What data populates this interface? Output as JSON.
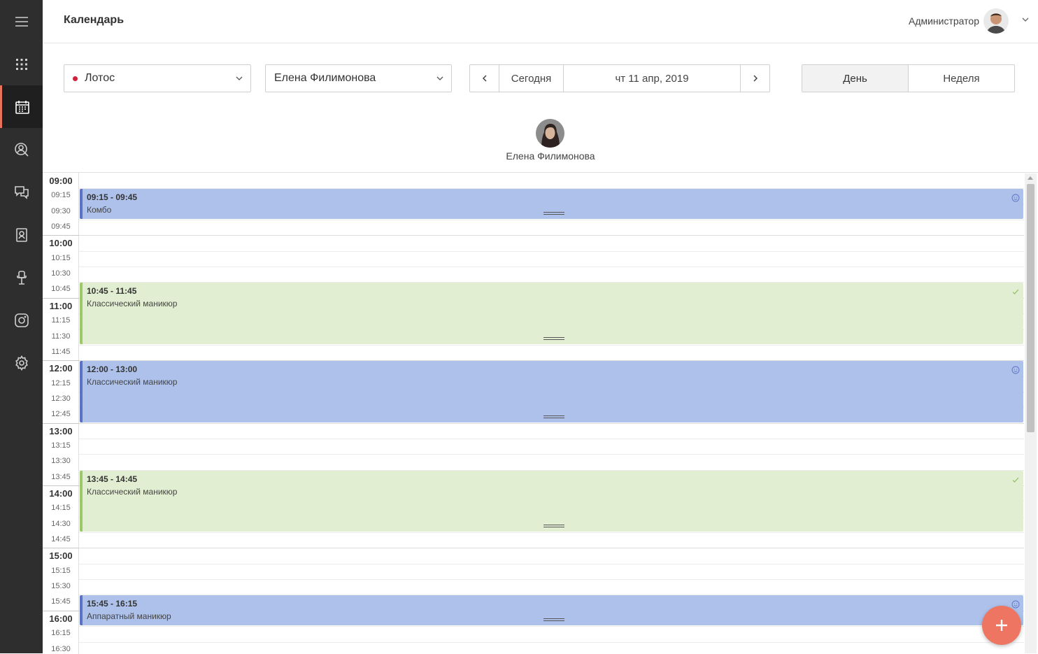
{
  "header": {
    "title": "Календарь",
    "user_name": "Администратор"
  },
  "sidebar": {
    "items": [
      {
        "name": "menu",
        "icon": "hamburger-menu-icon"
      },
      {
        "name": "apps",
        "icon": "apps-grid-icon"
      },
      {
        "name": "calendar",
        "icon": "calendar-icon",
        "active": true
      },
      {
        "name": "clients",
        "icon": "clients-search-icon"
      },
      {
        "name": "chat",
        "icon": "chat-icon"
      },
      {
        "name": "staff",
        "icon": "staff-badge-icon"
      },
      {
        "name": "workplace",
        "icon": "chair-icon"
      },
      {
        "name": "instagram",
        "icon": "instagram-icon"
      },
      {
        "name": "settings",
        "icon": "gear-icon"
      }
    ]
  },
  "toolbar": {
    "salon_value": "Лотос",
    "salon_dot_color": "#d0213b",
    "staff_value": "Елена Филимонова",
    "prev_label": "‹",
    "today_label": "Сегодня",
    "date_label": "чт 11 апр, 2019",
    "next_label": "›",
    "view_day_label": "День",
    "view_week_label": "Неделя"
  },
  "staff": {
    "name": "Елена Филимонова"
  },
  "time_labels": [
    "09:00",
    "09:15",
    "09:30",
    "09:45",
    "10:00",
    "10:15",
    "10:30",
    "10:45",
    "11:00",
    "11:15",
    "11:30",
    "11:45",
    "12:00",
    "12:15",
    "12:30",
    "12:45",
    "13:00",
    "13:15",
    "13:30",
    "13:45",
    "14:00",
    "14:15",
    "14:30",
    "14:45",
    "15:00",
    "15:15",
    "15:30",
    "15:45",
    "16:00",
    "16:15",
    "16:30"
  ],
  "events": [
    {
      "time": "09:15 - 09:45",
      "title": "Комбо",
      "status": "booked",
      "icon": "smiley-icon"
    },
    {
      "time": "10:45 - 11:45",
      "title": "Классический маникюр",
      "status": "confirmed",
      "icon": "check-icon"
    },
    {
      "time": "12:00 - 13:00",
      "title": "Классический маникюр",
      "status": "booked",
      "icon": "smiley-icon"
    },
    {
      "time": "13:45 - 14:45",
      "title": "Классический маникюр",
      "status": "confirmed",
      "icon": "check-icon"
    },
    {
      "time": "15:45 - 16:15",
      "title": "Аппаратный маникюр",
      "status": "booked",
      "icon": "smiley-icon"
    }
  ],
  "colors": {
    "accent": "#e8735a",
    "booked_bg": "#adc1ea",
    "booked_border": "#5c73c4",
    "confirmed_bg": "#e2eed1",
    "confirmed_border": "#9cc86a",
    "fab": "#ed7561"
  }
}
